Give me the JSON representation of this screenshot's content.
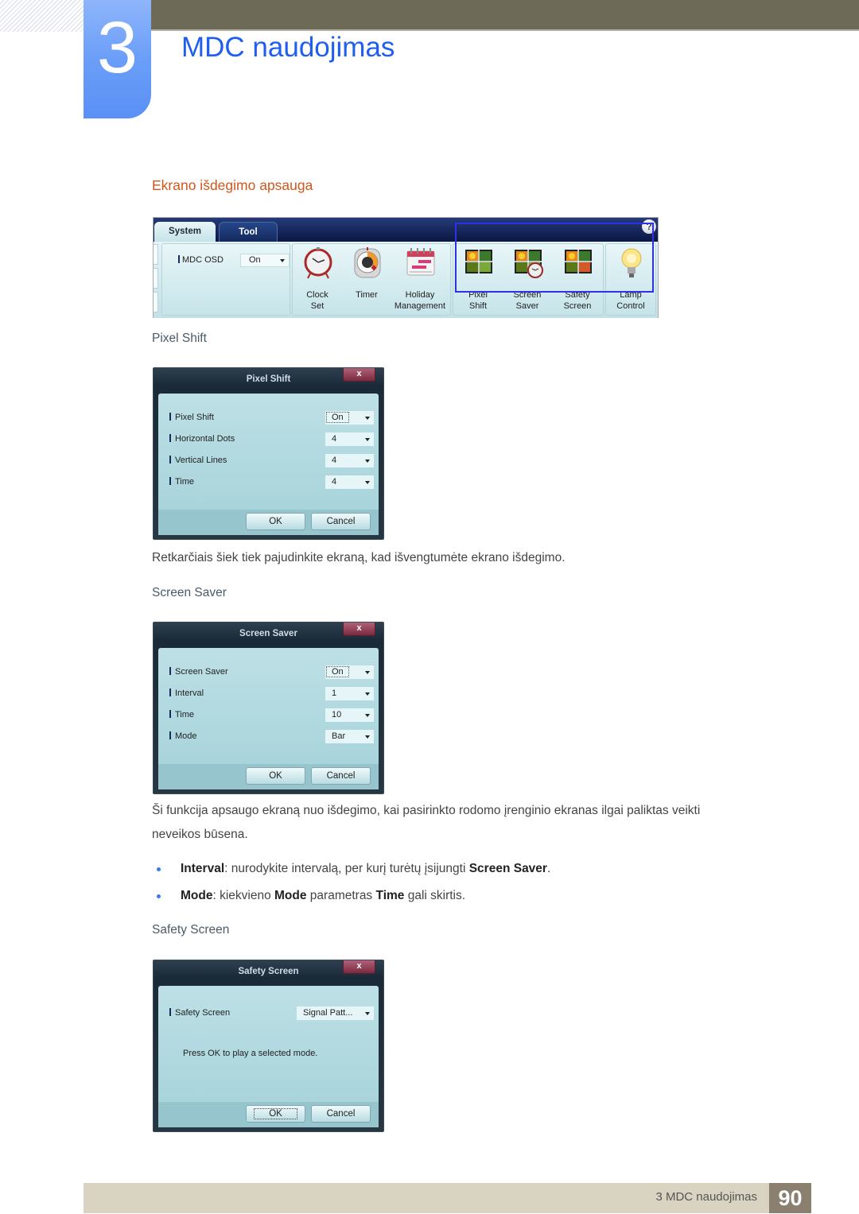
{
  "header": {
    "chapter_number": "3",
    "chapter_title": "MDC naudojimas"
  },
  "section": {
    "heading": "Ekrano išdegimo apsauga"
  },
  "ribbon": {
    "tabs": [
      {
        "label": "System",
        "active": true
      },
      {
        "label": "Tool",
        "active": false
      }
    ],
    "help_label": "?",
    "mdc_osd": {
      "label": "MDC OSD",
      "value": "On"
    },
    "buttons": [
      {
        "icon": "alarm-clock-icon",
        "line1": "Clock",
        "line2": "Set"
      },
      {
        "icon": "timer-icon",
        "line1": "Timer",
        "line2": ""
      },
      {
        "icon": "calendar-icon",
        "line1": "Holiday",
        "line2": "Management"
      },
      {
        "icon": "pixel-shift-icon",
        "line1": "Pixel",
        "line2": "Shift"
      },
      {
        "icon": "screen-saver-icon",
        "line1": "Screen",
        "line2": "Saver"
      },
      {
        "icon": "safety-screen-icon",
        "line1": "Safety",
        "line2": "Screen"
      },
      {
        "icon": "lamp-bulb-icon",
        "line1": "Lamp",
        "line2": "Control"
      }
    ],
    "highlight_color": "#3030e8"
  },
  "pixel_shift": {
    "subheading": "Pixel Shift",
    "dialog": {
      "title": "Pixel Shift",
      "close_label": "x",
      "rows": [
        {
          "label": "Pixel Shift",
          "value": "On"
        },
        {
          "label": "Horizontal Dots",
          "value": "4"
        },
        {
          "label": "Vertical Lines",
          "value": "4"
        },
        {
          "label": "Time",
          "value": "4"
        }
      ],
      "ok_label": "OK",
      "cancel_label": "Cancel"
    },
    "description": "Retkarčiais šiek tiek pajudinkite ekraną, kad išvengtumėte ekrano išdegimo."
  },
  "screen_saver": {
    "subheading": "Screen Saver",
    "dialog": {
      "title": "Screen Saver",
      "close_label": "x",
      "rows": [
        {
          "label": "Screen Saver",
          "value": "On"
        },
        {
          "label": "Interval",
          "value": "1"
        },
        {
          "label": "Time",
          "value": "10"
        },
        {
          "label": "Mode",
          "value": "Bar"
        }
      ],
      "ok_label": "OK",
      "cancel_label": "Cancel"
    },
    "description_line1": "Ši funkcija apsaugo ekraną nuo išdegimo, kai pasirinkto rodomo įrenginio ekranas ilgai paliktas veikti",
    "description_line2": "neveikos būsena.",
    "bullets": [
      {
        "term": "Interval",
        "text_a": ": nurodykite intervalą, per kurį turėtų įsijungti ",
        "term2": "Screen Saver",
        "text_b": ".",
        "term3": "",
        "text_c": ""
      },
      {
        "term": "Mode",
        "text_a": ": kiekvieno ",
        "term2": "Mode",
        "text_b": " parametras ",
        "term3": "Time",
        "text_c": " gali skirtis."
      }
    ]
  },
  "safety_screen": {
    "subheading": "Safety Screen",
    "dialog": {
      "title": "Safety Screen",
      "close_label": "x",
      "rows": [
        {
          "label": "Safety Screen",
          "value": "Signal Patt..."
        }
      ],
      "note": "Press OK to play a selected mode.",
      "ok_label": "OK",
      "cancel_label": "Cancel"
    }
  },
  "footer": {
    "text": "3 MDC naudojimas",
    "page_number": "90"
  }
}
